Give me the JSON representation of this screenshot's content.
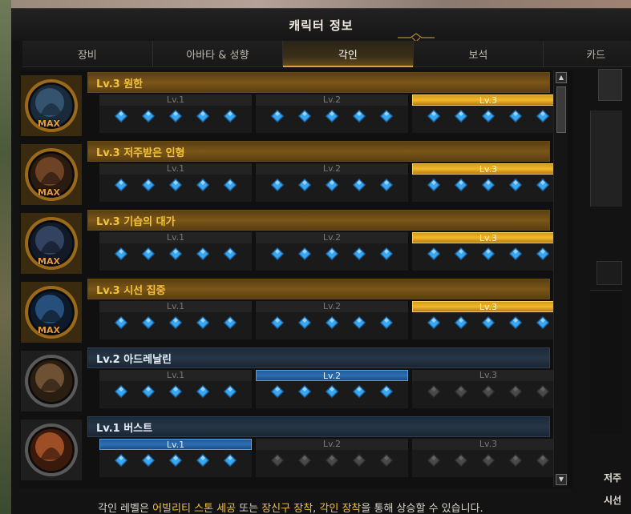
{
  "window": {
    "title": "캐릭터 정보"
  },
  "tabs": [
    {
      "label": "장비"
    },
    {
      "label": "아바타 & 성향"
    },
    {
      "label": "각인",
      "active": true
    },
    {
      "label": "보석"
    },
    {
      "label": "카드"
    }
  ],
  "engravings": [
    {
      "name": "Lv.3 원한",
      "level": 3,
      "max": true,
      "max_label": "MAX",
      "icon": "grudge-engraving-icon"
    },
    {
      "name": "Lv.3 저주받은 인형",
      "level": 3,
      "max": true,
      "max_label": "MAX",
      "icon": "cursed-doll-engraving-icon"
    },
    {
      "name": "Lv.3 기습의 대가",
      "level": 3,
      "max": true,
      "max_label": "MAX",
      "icon": "master-ambusher-engraving-icon"
    },
    {
      "name": "Lv.3 시선 집중",
      "level": 3,
      "max": true,
      "max_label": "MAX",
      "icon": "hit-master-engraving-icon"
    },
    {
      "name": "Lv.2 아드레날린",
      "level": 2,
      "max": false,
      "max_label": "",
      "icon": "adrenaline-engraving-icon"
    },
    {
      "name": "Lv.1 버스트",
      "level": 1,
      "max": false,
      "max_label": "",
      "icon": "burst-engraving-icon"
    }
  ],
  "level_labels": [
    "Lv.1",
    "Lv.2",
    "Lv.3"
  ],
  "right_panel": {
    "label1": "저주",
    "label2": "시선"
  },
  "footer": {
    "part1": "각인 레벨은 ",
    "highlight1": "어빌리티 스톤 세공",
    "part2": " 또는 ",
    "highlight2": "장신구 장착",
    "part3": ", ",
    "highlight3": "각인 장착",
    "part4": "을 통해 상승할 수 있습니다."
  },
  "colors": {
    "gold": "#f4c23a",
    "blue_active": "#2d6fb3",
    "gem_active": "#3aa8f0",
    "gem_inactive": "#4a4a4a"
  }
}
